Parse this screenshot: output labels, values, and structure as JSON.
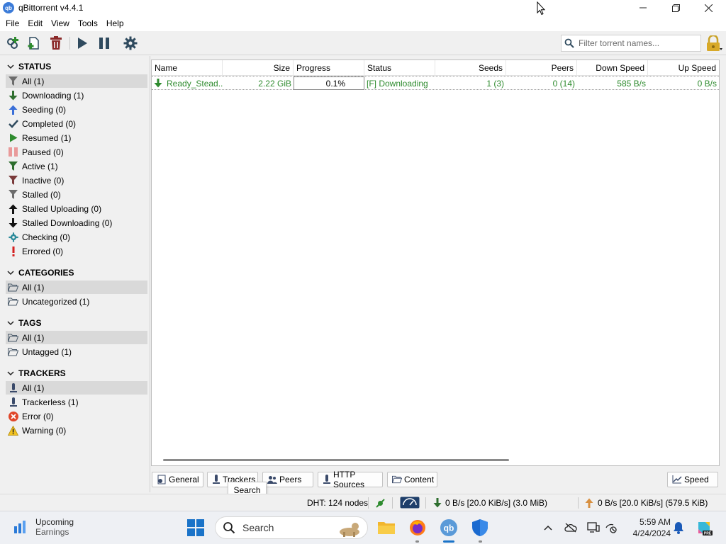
{
  "window": {
    "title": "qBittorrent v4.4.1",
    "app_icon_text": "qb"
  },
  "menu": [
    "File",
    "Edit",
    "View",
    "Tools",
    "Help"
  ],
  "toolbar": {
    "search_placeholder": "Filter torrent names..."
  },
  "sidebar": {
    "status": {
      "header": "STATUS",
      "items": [
        {
          "label": "All (1)",
          "icon": "filter-icon"
        },
        {
          "label": "Downloading (1)",
          "icon": "arrow-down-icon"
        },
        {
          "label": "Seeding (0)",
          "icon": "arrow-up-icon"
        },
        {
          "label": "Completed (0)",
          "icon": "checkmark-icon"
        },
        {
          "label": "Resumed (1)",
          "icon": "play-icon"
        },
        {
          "label": "Paused (0)",
          "icon": "pause-icon"
        },
        {
          "label": "Active (1)",
          "icon": "filter-icon"
        },
        {
          "label": "Inactive (0)",
          "icon": "filter-icon"
        },
        {
          "label": "Stalled (0)",
          "icon": "filter-icon"
        },
        {
          "label": "Stalled Uploading (0)",
          "icon": "arrow-up-icon"
        },
        {
          "label": "Stalled Downloading (0)",
          "icon": "arrow-down-icon"
        },
        {
          "label": "Checking (0)",
          "icon": "gear-icon"
        },
        {
          "label": "Errored (0)",
          "icon": "exclamation-icon"
        }
      ]
    },
    "categories": {
      "header": "CATEGORIES",
      "items": [
        {
          "label": "All (1)",
          "icon": "folder-open-icon"
        },
        {
          "label": "Uncategorized (1)",
          "icon": "folder-open-icon"
        }
      ]
    },
    "tags": {
      "header": "TAGS",
      "items": [
        {
          "label": "All (1)",
          "icon": "folder-open-icon"
        },
        {
          "label": "Untagged (1)",
          "icon": "folder-open-icon"
        }
      ]
    },
    "trackers": {
      "header": "TRACKERS",
      "items": [
        {
          "label": "All (1)",
          "icon": "tracker-icon"
        },
        {
          "label": "Trackerless (1)",
          "icon": "tracker-icon"
        },
        {
          "label": "Error (0)",
          "icon": "error-icon"
        },
        {
          "label": "Warning (0)",
          "icon": "warning-icon"
        }
      ]
    }
  },
  "table": {
    "columns": [
      "Name",
      "Size",
      "Progress",
      "Status",
      "Seeds",
      "Peers",
      "Down Speed",
      "Up Speed"
    ],
    "rows": [
      {
        "name": "Ready_Stead...",
        "size": "2.22 GiB",
        "progress": "0.1%",
        "status": "[F] Downloading",
        "seeds": "1 (3)",
        "peers": "0 (14)",
        "down_speed": "585 B/s",
        "up_speed": "0 B/s"
      }
    ]
  },
  "tabs": [
    "General",
    "Trackers",
    "Peers",
    "HTTP Sources",
    "Content"
  ],
  "speed_button": "Speed",
  "tooltip": "Search",
  "statusbar": {
    "dht": "DHT: 124 nodes",
    "download": "0 B/s [20.0 KiB/s] (3.0 MiB)",
    "upload": "0 B/s [20.0 KiB/s] (579.5 KiB)"
  },
  "taskbar": {
    "widget_title": "Upcoming",
    "widget_subtitle": "Earnings",
    "search_label": "Search",
    "time": "5:59 AM",
    "date": "4/24/2024"
  },
  "colors": {
    "status_green": "#2e8b2e",
    "selection": "#d9d9d9",
    "accent_blue": "#1a73c8"
  }
}
